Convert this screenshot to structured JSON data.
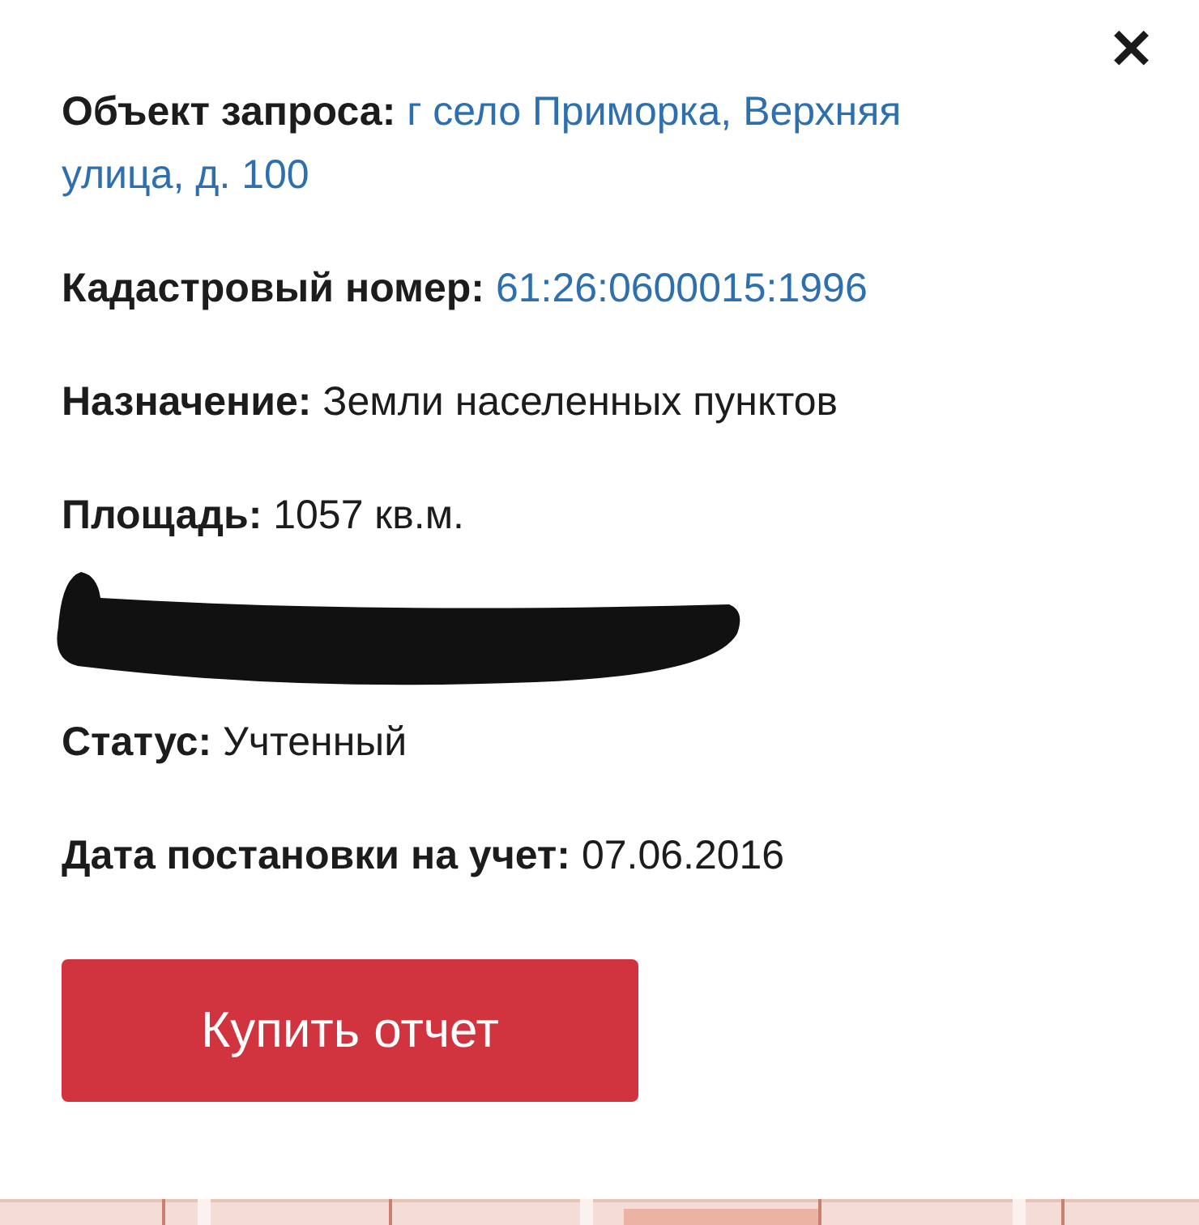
{
  "close": {
    "label": "✕"
  },
  "fields": [
    {
      "kind": "field",
      "label": "Объект запроса:",
      "value": "г село Приморка, Верхняя улица, д. 100",
      "link": true
    },
    {
      "kind": "field",
      "label": "Кадастровый номер:",
      "value": "61:26:0600015:1996",
      "link": true
    },
    {
      "kind": "field",
      "label": "Назначение:",
      "value": "Земли населенных пунктов",
      "link": false
    },
    {
      "kind": "field",
      "label": "Площадь:",
      "value": "1057 кв.м.",
      "link": false
    },
    {
      "kind": "redacted"
    },
    {
      "kind": "field",
      "label": "Статус:",
      "value": "Учтенный",
      "link": false
    },
    {
      "kind": "field",
      "label": "Дата постановки на учет:",
      "value": "07.06.2016",
      "link": false
    }
  ],
  "button": {
    "label": "Купить отчет"
  }
}
